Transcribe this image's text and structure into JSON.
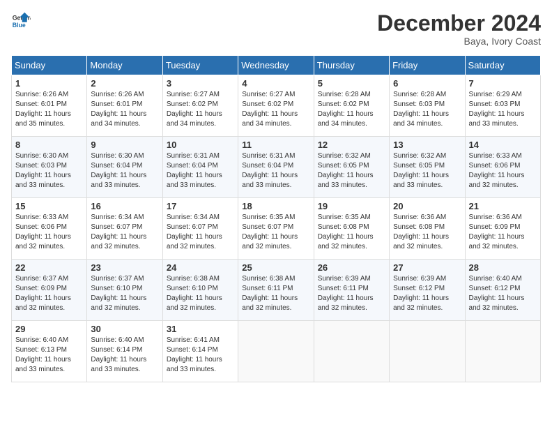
{
  "header": {
    "logo_line1": "General",
    "logo_line2": "Blue",
    "month": "December 2024",
    "location": "Baya, Ivory Coast"
  },
  "weekdays": [
    "Sunday",
    "Monday",
    "Tuesday",
    "Wednesday",
    "Thursday",
    "Friday",
    "Saturday"
  ],
  "weeks": [
    [
      {
        "day": "1",
        "info": "Sunrise: 6:26 AM\nSunset: 6:01 PM\nDaylight: 11 hours\nand 35 minutes."
      },
      {
        "day": "2",
        "info": "Sunrise: 6:26 AM\nSunset: 6:01 PM\nDaylight: 11 hours\nand 34 minutes."
      },
      {
        "day": "3",
        "info": "Sunrise: 6:27 AM\nSunset: 6:02 PM\nDaylight: 11 hours\nand 34 minutes."
      },
      {
        "day": "4",
        "info": "Sunrise: 6:27 AM\nSunset: 6:02 PM\nDaylight: 11 hours\nand 34 minutes."
      },
      {
        "day": "5",
        "info": "Sunrise: 6:28 AM\nSunset: 6:02 PM\nDaylight: 11 hours\nand 34 minutes."
      },
      {
        "day": "6",
        "info": "Sunrise: 6:28 AM\nSunset: 6:03 PM\nDaylight: 11 hours\nand 34 minutes."
      },
      {
        "day": "7",
        "info": "Sunrise: 6:29 AM\nSunset: 6:03 PM\nDaylight: 11 hours\nand 33 minutes."
      }
    ],
    [
      {
        "day": "8",
        "info": "Sunrise: 6:30 AM\nSunset: 6:03 PM\nDaylight: 11 hours\nand 33 minutes."
      },
      {
        "day": "9",
        "info": "Sunrise: 6:30 AM\nSunset: 6:04 PM\nDaylight: 11 hours\nand 33 minutes."
      },
      {
        "day": "10",
        "info": "Sunrise: 6:31 AM\nSunset: 6:04 PM\nDaylight: 11 hours\nand 33 minutes."
      },
      {
        "day": "11",
        "info": "Sunrise: 6:31 AM\nSunset: 6:04 PM\nDaylight: 11 hours\nand 33 minutes."
      },
      {
        "day": "12",
        "info": "Sunrise: 6:32 AM\nSunset: 6:05 PM\nDaylight: 11 hours\nand 33 minutes."
      },
      {
        "day": "13",
        "info": "Sunrise: 6:32 AM\nSunset: 6:05 PM\nDaylight: 11 hours\nand 33 minutes."
      },
      {
        "day": "14",
        "info": "Sunrise: 6:33 AM\nSunset: 6:06 PM\nDaylight: 11 hours\nand 32 minutes."
      }
    ],
    [
      {
        "day": "15",
        "info": "Sunrise: 6:33 AM\nSunset: 6:06 PM\nDaylight: 11 hours\nand 32 minutes."
      },
      {
        "day": "16",
        "info": "Sunrise: 6:34 AM\nSunset: 6:07 PM\nDaylight: 11 hours\nand 32 minutes."
      },
      {
        "day": "17",
        "info": "Sunrise: 6:34 AM\nSunset: 6:07 PM\nDaylight: 11 hours\nand 32 minutes."
      },
      {
        "day": "18",
        "info": "Sunrise: 6:35 AM\nSunset: 6:07 PM\nDaylight: 11 hours\nand 32 minutes."
      },
      {
        "day": "19",
        "info": "Sunrise: 6:35 AM\nSunset: 6:08 PM\nDaylight: 11 hours\nand 32 minutes."
      },
      {
        "day": "20",
        "info": "Sunrise: 6:36 AM\nSunset: 6:08 PM\nDaylight: 11 hours\nand 32 minutes."
      },
      {
        "day": "21",
        "info": "Sunrise: 6:36 AM\nSunset: 6:09 PM\nDaylight: 11 hours\nand 32 minutes."
      }
    ],
    [
      {
        "day": "22",
        "info": "Sunrise: 6:37 AM\nSunset: 6:09 PM\nDaylight: 11 hours\nand 32 minutes."
      },
      {
        "day": "23",
        "info": "Sunrise: 6:37 AM\nSunset: 6:10 PM\nDaylight: 11 hours\nand 32 minutes."
      },
      {
        "day": "24",
        "info": "Sunrise: 6:38 AM\nSunset: 6:10 PM\nDaylight: 11 hours\nand 32 minutes."
      },
      {
        "day": "25",
        "info": "Sunrise: 6:38 AM\nSunset: 6:11 PM\nDaylight: 11 hours\nand 32 minutes."
      },
      {
        "day": "26",
        "info": "Sunrise: 6:39 AM\nSunset: 6:11 PM\nDaylight: 11 hours\nand 32 minutes."
      },
      {
        "day": "27",
        "info": "Sunrise: 6:39 AM\nSunset: 6:12 PM\nDaylight: 11 hours\nand 32 minutes."
      },
      {
        "day": "28",
        "info": "Sunrise: 6:40 AM\nSunset: 6:12 PM\nDaylight: 11 hours\nand 32 minutes."
      }
    ],
    [
      {
        "day": "29",
        "info": "Sunrise: 6:40 AM\nSunset: 6:13 PM\nDaylight: 11 hours\nand 33 minutes."
      },
      {
        "day": "30",
        "info": "Sunrise: 6:40 AM\nSunset: 6:14 PM\nDaylight: 11 hours\nand 33 minutes."
      },
      {
        "day": "31",
        "info": "Sunrise: 6:41 AM\nSunset: 6:14 PM\nDaylight: 11 hours\nand 33 minutes."
      },
      null,
      null,
      null,
      null
    ]
  ]
}
